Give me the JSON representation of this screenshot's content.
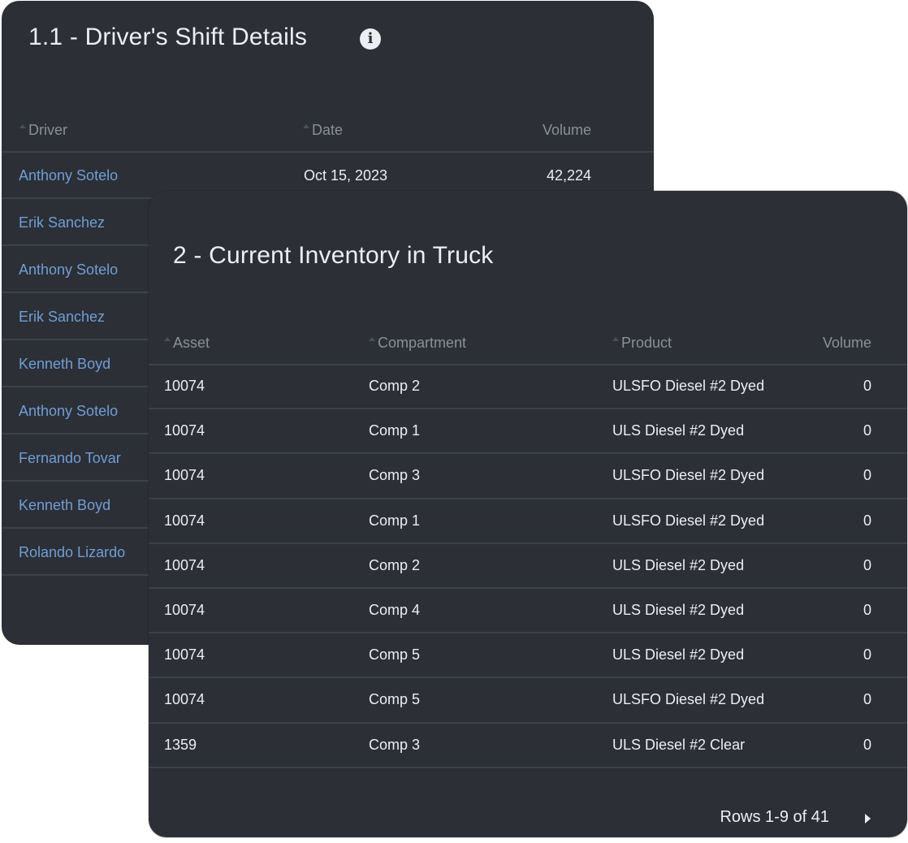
{
  "shift_panel": {
    "title": "1.1 - Driver's Shift Details",
    "icon": "info-icon",
    "columns": [
      "Driver",
      "Date",
      "Volume"
    ],
    "rows": [
      {
        "driver": "Anthony Sotelo",
        "date": "Oct 15, 2023",
        "volume": "42,224"
      },
      {
        "driver": "Erik Sanchez"
      },
      {
        "driver": "Anthony Sotelo"
      },
      {
        "driver": "Erik Sanchez"
      },
      {
        "driver": "Kenneth Boyd"
      },
      {
        "driver": "Anthony Sotelo"
      },
      {
        "driver": "Fernando Tovar"
      },
      {
        "driver": "Kenneth Boyd"
      },
      {
        "driver": "Rolando Lizardo"
      }
    ]
  },
  "inventory_panel": {
    "title": "2 - Current Inventory in Truck",
    "columns": [
      "Asset",
      "Compartment",
      "Product",
      "Volume"
    ],
    "rows": [
      {
        "asset": "10074",
        "compartment": "Comp 2",
        "product": "ULSFO Diesel #2 Dyed",
        "volume": "0"
      },
      {
        "asset": "10074",
        "compartment": "Comp 1",
        "product": "ULS Diesel #2 Dyed",
        "volume": "0"
      },
      {
        "asset": "10074",
        "compartment": "Comp 3",
        "product": "ULSFO Diesel #2 Dyed",
        "volume": "0"
      },
      {
        "asset": "10074",
        "compartment": "Comp 1",
        "product": "ULSFO Diesel #2 Dyed",
        "volume": "0"
      },
      {
        "asset": "10074",
        "compartment": "Comp 2",
        "product": "ULS Diesel #2 Dyed",
        "volume": "0"
      },
      {
        "asset": "10074",
        "compartment": "Comp 4",
        "product": "ULS Diesel #2 Dyed",
        "volume": "0"
      },
      {
        "asset": "10074",
        "compartment": "Comp 5",
        "product": "ULS Diesel #2 Dyed",
        "volume": "0"
      },
      {
        "asset": "10074",
        "compartment": "Comp 5",
        "product": "ULSFO Diesel #2 Dyed",
        "volume": "0"
      },
      {
        "asset": "1359",
        "compartment": "Comp 3",
        "product": "ULS Diesel #2 Clear",
        "volume": "0"
      }
    ],
    "pagination": "Rows 1-9 of 41",
    "next_icon": "chevron-right-icon"
  },
  "colors": {
    "panel_bg": "#2c2f36",
    "link": "#6f9ed6",
    "text": "#eceef2",
    "header_text": "#8a8f98"
  }
}
